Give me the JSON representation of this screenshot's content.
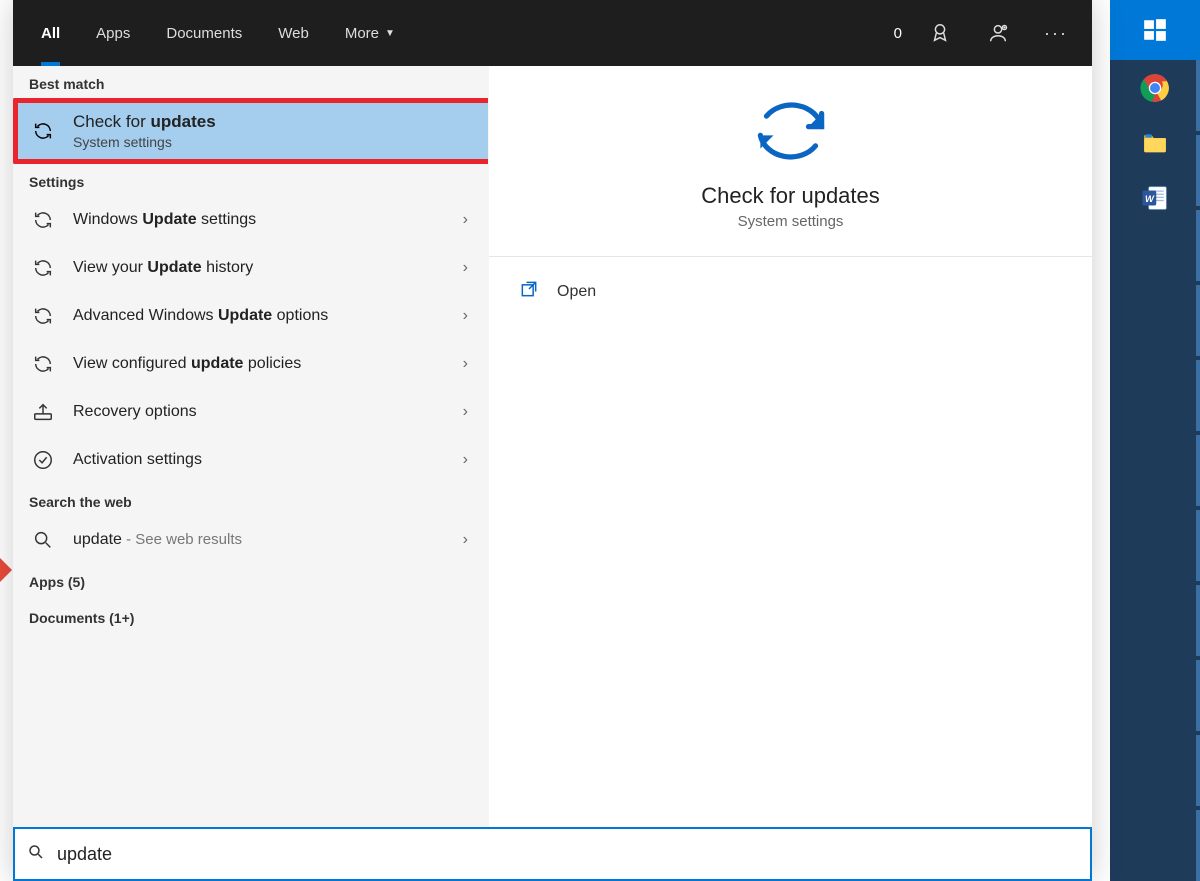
{
  "filters": {
    "all": "All",
    "apps": "Apps",
    "documents": "Documents",
    "web": "Web",
    "more": "More",
    "points": "0"
  },
  "left": {
    "best_match_header": "Best match",
    "best_match": {
      "title_pre": "Check for ",
      "title_bold": "updates",
      "title_post": "",
      "sub": "System settings"
    },
    "settings_header": "Settings",
    "settings": [
      {
        "pre": "Windows ",
        "bold": "Update",
        "post": " settings"
      },
      {
        "pre": "View your ",
        "bold": "Update",
        "post": " history"
      },
      {
        "pre": "Advanced Windows ",
        "bold": "Update",
        "post": " options"
      },
      {
        "pre": "View configured ",
        "bold": "update",
        "post": " policies"
      },
      {
        "pre": "Recovery options",
        "bold": "",
        "post": ""
      },
      {
        "pre": "Activation settings",
        "bold": "",
        "post": ""
      }
    ],
    "web_header": "Search the web",
    "web": {
      "query": "update",
      "suffix": " - See web results"
    },
    "apps_collapse": "Apps (5)",
    "docs_collapse": "Documents (1+)"
  },
  "detail": {
    "title": "Check for updates",
    "sub": "System settings",
    "open": "Open"
  },
  "search": {
    "value": "update"
  }
}
